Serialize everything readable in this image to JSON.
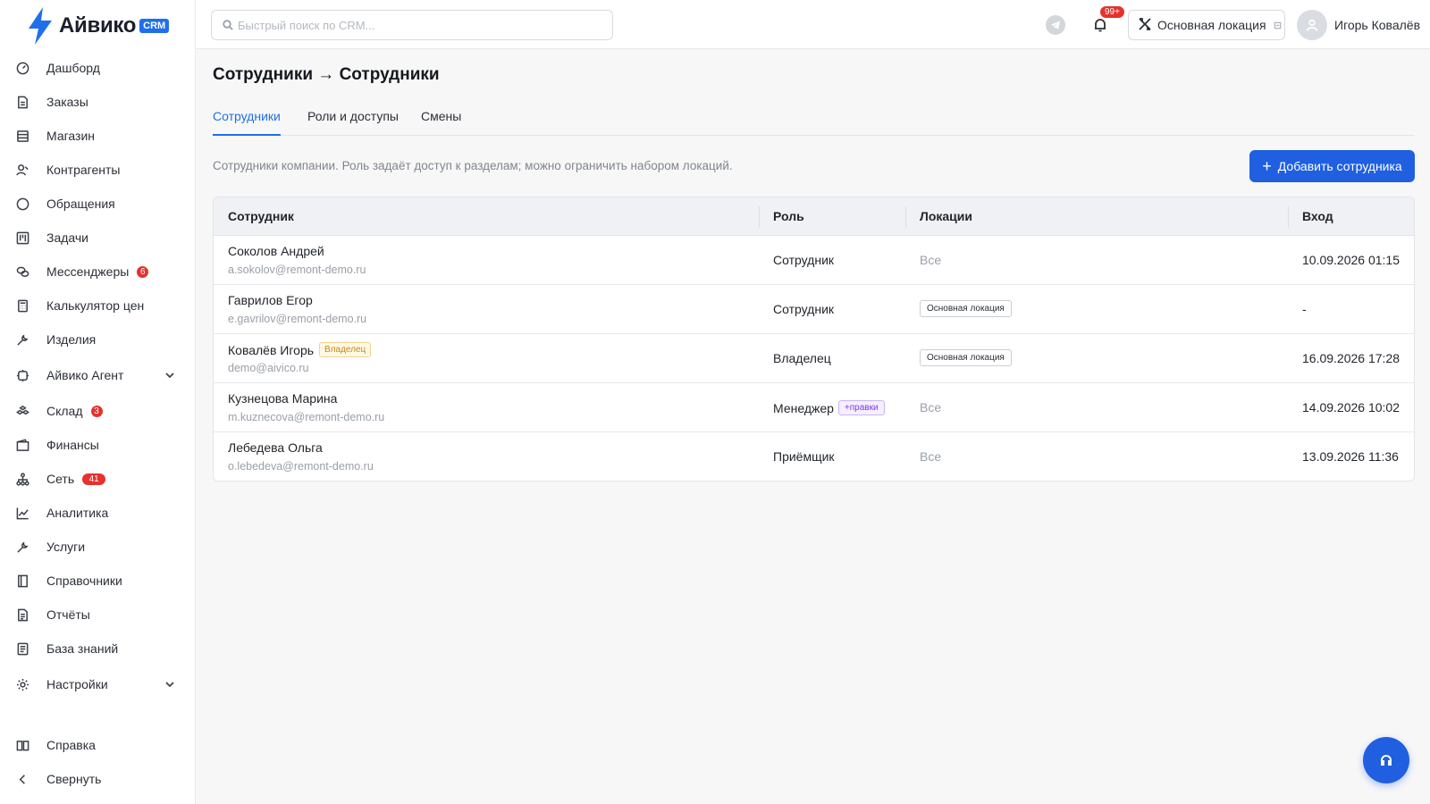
{
  "brand": {
    "name": "Айвико",
    "badge": "CRM",
    "accent": "#1f6feb"
  },
  "sidebar": {
    "items": [
      {
        "label": "Дашборд",
        "icon": "dashboard-icon"
      },
      {
        "label": "Заказы",
        "icon": "document-icon"
      },
      {
        "label": "Магазин",
        "icon": "store-icon"
      },
      {
        "label": "Контрагенты",
        "icon": "contacts-icon"
      },
      {
        "label": "Обращения",
        "icon": "chat-icon"
      },
      {
        "label": "Задачи",
        "icon": "kanban-icon"
      },
      {
        "label": "Мессенджеры",
        "icon": "messengers-icon",
        "badge": "6"
      },
      {
        "label": "Калькулятор цен",
        "icon": "calculator-icon"
      },
      {
        "label": "Изделия",
        "icon": "wrench-icon"
      },
      {
        "label": "Айвико Агент",
        "icon": "agent-icon",
        "expandable": true
      },
      {
        "label": "Склад",
        "icon": "warehouse-icon",
        "badge": "3"
      },
      {
        "label": "Финансы",
        "icon": "wallet-icon"
      },
      {
        "label": "Сеть",
        "icon": "network-icon",
        "badge": "41"
      },
      {
        "label": "Аналитика",
        "icon": "chart-icon"
      },
      {
        "label": "Услуги",
        "icon": "tools-icon"
      },
      {
        "label": "Справочники",
        "icon": "book-icon"
      },
      {
        "label": "Отчёты",
        "icon": "report-icon"
      },
      {
        "label": "База знаний",
        "icon": "knowledge-icon"
      },
      {
        "label": "Настройки",
        "icon": "settings-icon",
        "expandable": true
      }
    ],
    "footer": [
      {
        "label": "Справка",
        "icon": "help-book-icon"
      },
      {
        "label": "Свернуть",
        "icon": "chevron-left-icon"
      }
    ]
  },
  "topbar": {
    "search_placeholder": "Быстрый поиск по CRM...",
    "notifications_badge": "99+",
    "location": "Основная локация",
    "user_name": "Игорь Ковалёв"
  },
  "page": {
    "title": "Сотрудники → Сотрудники",
    "tabs": [
      {
        "label": "Сотрудники",
        "active": true
      },
      {
        "label": "Роли и доступы",
        "active": false
      },
      {
        "label": "Смены",
        "active": false
      }
    ],
    "description": "Сотрудники компании. Роль задаёт доступ к разделам; можно ограничить набором локаций.",
    "add_button": "Добавить сотрудника"
  },
  "table": {
    "columns": [
      "Сотрудник",
      "Роль",
      "Локации",
      "Вход"
    ],
    "rows": [
      {
        "name": "Соколов Андрей",
        "email": "a.sokolov@remont-demo.ru",
        "role": "Сотрудник",
        "locations": "Все",
        "location_is_tag": false,
        "login": "10.09.2026 01:15"
      },
      {
        "name": "Гаврилов Егор",
        "email": "e.gavrilov@remont-demo.ru",
        "role": "Сотрудник",
        "locations": "Основная локация",
        "location_is_tag": true,
        "login": "-"
      },
      {
        "name": "Ковалёв Игорь",
        "name_tag": "Владелец",
        "email": "demo@aivico.ru",
        "role": "Владелец",
        "locations": "Основная локация",
        "location_is_tag": true,
        "login": "16.09.2026 17:28"
      },
      {
        "name": "Кузнецова Марина",
        "email": "m.kuznecova@remont-demo.ru",
        "role": "Менеджер",
        "role_tag": "+правки",
        "locations": "Все",
        "location_is_tag": false,
        "login": "14.09.2026 10:02"
      },
      {
        "name": "Лебедева Ольга",
        "email": "o.lebedeva@remont-demo.ru",
        "role": "Приёмщик",
        "locations": "Все",
        "location_is_tag": false,
        "login": "13.09.2026 11:36"
      }
    ]
  }
}
